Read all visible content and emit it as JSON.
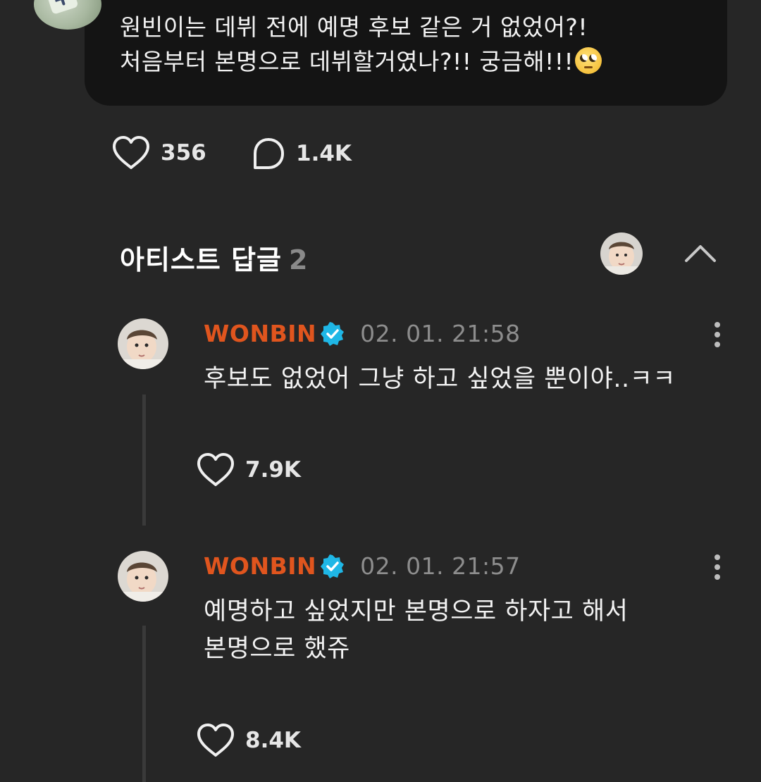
{
  "post": {
    "line1": "원빈이는 데뷔 전에 예명 후보 같은 거 없었어?!",
    "line2": "처음부터 본명으로 데뷔할거였나?!! 궁금해!!!",
    "emoji": "eye-roll-emoji",
    "likes": "356",
    "comments": "1.4K"
  },
  "section": {
    "title": "아티스트 답글",
    "count": "2"
  },
  "replies": [
    {
      "name": "WONBIN",
      "time": "02. 01. 21:58",
      "text": "후보도 없었어 그냥 하고 싶었을 뿐이야..ㅋㅋ",
      "likes": "7.9K"
    },
    {
      "name": "WONBIN",
      "time": "02. 01. 21:57",
      "text_line1": "예명하고 싶었지만 본명으로 하자고 해서",
      "text_line2": "본명으로 했쥬",
      "likes": "8.4K"
    }
  ],
  "colors": {
    "background": "#262626",
    "bubble": "#141414",
    "artist_name": "#e0551e",
    "verified": "#1fb7e6"
  }
}
